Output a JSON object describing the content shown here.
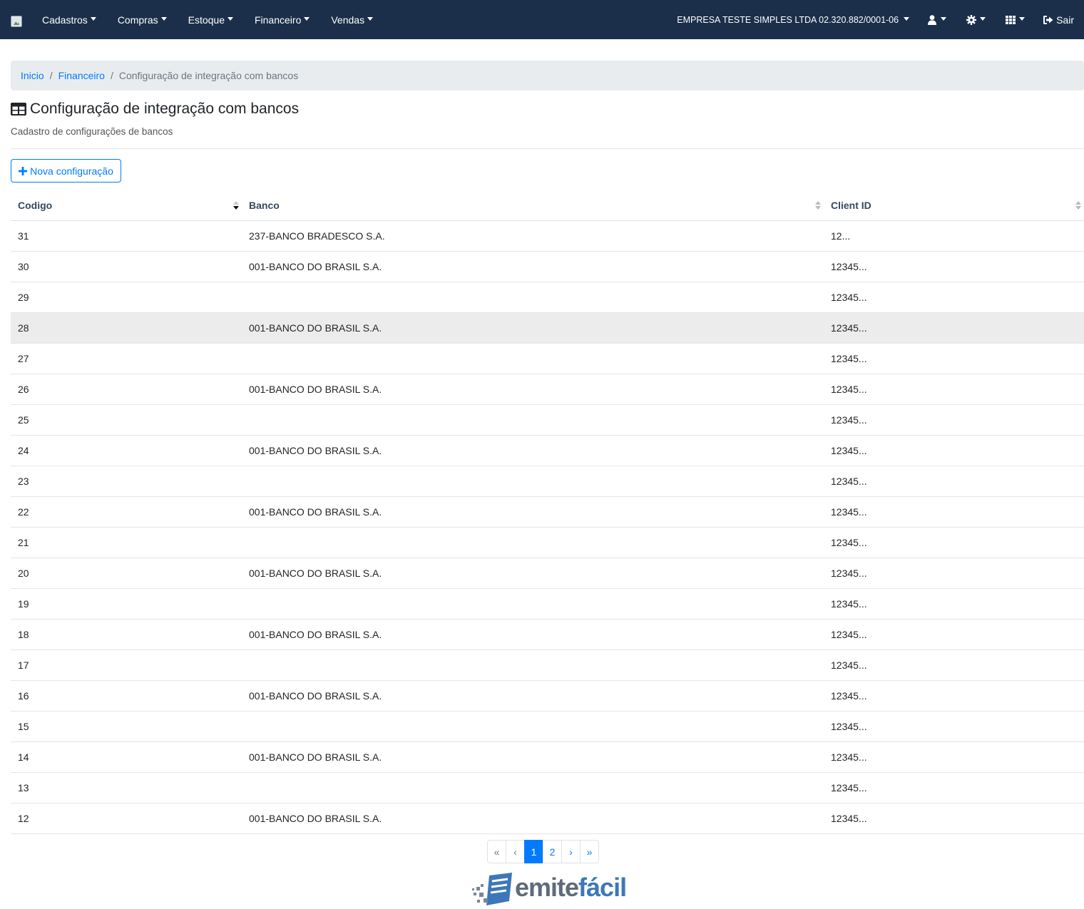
{
  "navbar": {
    "menus": [
      "Cadastros",
      "Compras",
      "Estoque",
      "Financeiro",
      "Vendas"
    ],
    "company": "EMPRESA TESTE SIMPLES LTDA 02.320.882/0001-06",
    "logout_label": "Sair",
    "icons": [
      "user-icon",
      "gear-icon",
      "grid-icon",
      "sign-out-icon"
    ]
  },
  "breadcrumb": {
    "home": "Inicio",
    "section": "Financeiro",
    "current": "Configuração de integração com bancos"
  },
  "page": {
    "title": "Configuração de integração com bancos",
    "subtitle": "Cadastro de configurações de bancos",
    "new_button": "Nova configuração"
  },
  "table": {
    "columns": [
      "Codigo",
      "Banco",
      "Client ID"
    ],
    "rows": [
      {
        "codigo": "31",
        "banco": "237-BANCO BRADESCO S.A.",
        "client_id": "12..."
      },
      {
        "codigo": "30",
        "banco": "001-BANCO DO BRASIL S.A.",
        "client_id": "12345..."
      },
      {
        "codigo": "29",
        "banco": "",
        "client_id": "12345..."
      },
      {
        "codigo": "28",
        "banco": "001-BANCO DO BRASIL S.A.",
        "client_id": "12345..."
      },
      {
        "codigo": "27",
        "banco": "",
        "client_id": "12345..."
      },
      {
        "codigo": "26",
        "banco": "001-BANCO DO BRASIL S.A.",
        "client_id": "12345..."
      },
      {
        "codigo": "25",
        "banco": "",
        "client_id": "12345..."
      },
      {
        "codigo": "24",
        "banco": "001-BANCO DO BRASIL S.A.",
        "client_id": "12345..."
      },
      {
        "codigo": "23",
        "banco": "",
        "client_id": "12345..."
      },
      {
        "codigo": "22",
        "banco": "001-BANCO DO BRASIL S.A.",
        "client_id": "12345..."
      },
      {
        "codigo": "21",
        "banco": "",
        "client_id": "12345..."
      },
      {
        "codigo": "20",
        "banco": "001-BANCO DO BRASIL S.A.",
        "client_id": "12345..."
      },
      {
        "codigo": "19",
        "banco": "",
        "client_id": "12345..."
      },
      {
        "codigo": "18",
        "banco": "001-BANCO DO BRASIL S.A.",
        "client_id": "12345..."
      },
      {
        "codigo": "17",
        "banco": "",
        "client_id": "12345..."
      },
      {
        "codigo": "16",
        "banco": "001-BANCO DO BRASIL S.A.",
        "client_id": "12345..."
      },
      {
        "codigo": "15",
        "banco": "",
        "client_id": "12345..."
      },
      {
        "codigo": "14",
        "banco": "001-BANCO DO BRASIL S.A.",
        "client_id": "12345..."
      },
      {
        "codigo": "13",
        "banco": "",
        "client_id": "12345..."
      },
      {
        "codigo": "12",
        "banco": "001-BANCO DO BRASIL S.A.",
        "client_id": "12345..."
      }
    ],
    "highlighted_row": 3
  },
  "pagination": {
    "first": "«",
    "prev": "‹",
    "pages": [
      "1",
      "2"
    ],
    "active_page": "1",
    "next": "›",
    "last": "»"
  },
  "footer": {
    "logo_text_part1": "emite",
    "logo_text_part2": "fácil"
  },
  "colors": {
    "navbar_bg": "#1b2f4a",
    "link": "#007bff",
    "header_text": "#34495e",
    "highlight_row": "#ececec"
  }
}
